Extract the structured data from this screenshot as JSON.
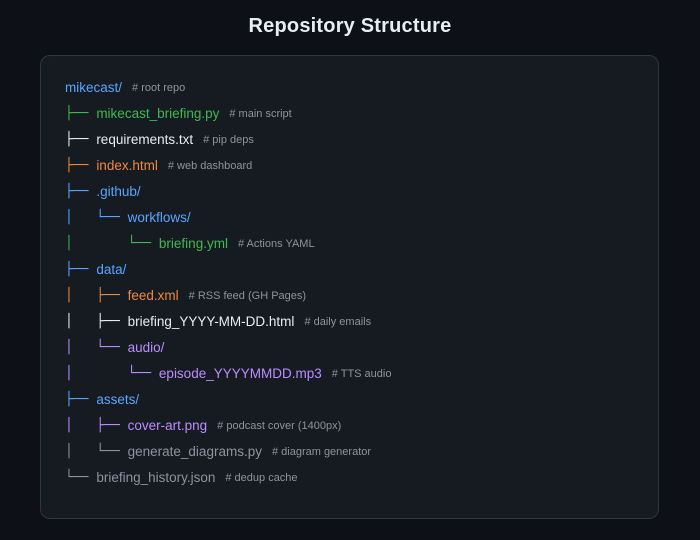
{
  "title": "Repository Structure",
  "colors": {
    "background": "#0d1117",
    "panel": "#161b22",
    "panel_border": "#30363d",
    "title": "#e6edf3",
    "comment": "#8b949e",
    "folder": "#58a6ff",
    "python": "#3fb950",
    "plain": "#e6edf3",
    "web": "#f0883e",
    "media": "#bc8cff",
    "muted": "#8b949e"
  },
  "tree": [
    {
      "prefix": "",
      "name": "mikecast/",
      "comment": "# root repo",
      "type": "folder",
      "prefix_type": "folder"
    },
    {
      "prefix": "├── ",
      "name": "mikecast_briefing.py",
      "comment": "# main script",
      "type": "python",
      "prefix_type": "python"
    },
    {
      "prefix": "├── ",
      "name": "requirements.txt",
      "comment": "# pip deps",
      "type": "plain",
      "prefix_type": "plain"
    },
    {
      "prefix": "├── ",
      "name": "index.html",
      "comment": "# web dashboard",
      "type": "web",
      "prefix_type": "web"
    },
    {
      "prefix": "├── ",
      "name": ".github/",
      "comment": "",
      "type": "folder",
      "prefix_type": "folder"
    },
    {
      "prefix": "│   └── ",
      "name": "workflows/",
      "comment": "",
      "type": "folder",
      "prefix_type": "folder"
    },
    {
      "prefix": "│       └── ",
      "name": "briefing.yml",
      "comment": "# Actions YAML",
      "type": "python",
      "prefix_type": "python"
    },
    {
      "prefix": "├── ",
      "name": "data/",
      "comment": "",
      "type": "folder",
      "prefix_type": "folder"
    },
    {
      "prefix": "│   ├── ",
      "name": "feed.xml",
      "comment": "# RSS feed (GH Pages)",
      "type": "web",
      "prefix_type": "web"
    },
    {
      "prefix": "│   ├── ",
      "name": "briefing_YYYY-MM-DD.html",
      "comment": "# daily emails",
      "type": "plain",
      "prefix_type": "plain"
    },
    {
      "prefix": "│   └── ",
      "name": "audio/",
      "comment": "",
      "type": "media",
      "prefix_type": "media"
    },
    {
      "prefix": "│       └── ",
      "name": "episode_YYYYMMDD.mp3",
      "comment": "# TTS audio",
      "type": "media",
      "prefix_type": "media"
    },
    {
      "prefix": "├── ",
      "name": "assets/",
      "comment": "",
      "type": "folder",
      "prefix_type": "folder"
    },
    {
      "prefix": "│   ├── ",
      "name": "cover-art.png",
      "comment": "# podcast cover (1400px)",
      "type": "media",
      "prefix_type": "media"
    },
    {
      "prefix": "│   └── ",
      "name": "generate_diagrams.py",
      "comment": "# diagram generator",
      "type": "muted",
      "prefix_type": "muted"
    },
    {
      "prefix": "└── ",
      "name": "briefing_history.json",
      "comment": "# dedup cache",
      "type": "muted",
      "prefix_type": "muted"
    }
  ]
}
